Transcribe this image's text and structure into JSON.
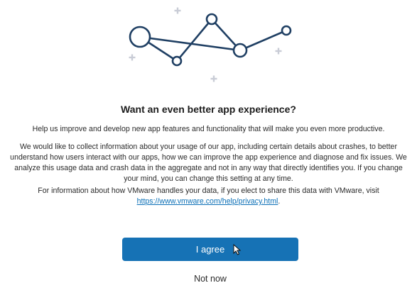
{
  "dialog": {
    "title": "Want an even better app experience?",
    "intro": "Help us improve and develop new app features and functionality that will make you even more productive.",
    "details": "We would like to collect information about your usage of our app, including certain details about crashes, to better understand how users interact with our apps, how we can improve the app experience and diagnose and fix issues. We analyze this usage data and crash data in the aggregate and not in any way that directly identifies you. If you change your mind, you can change this setting at any time.",
    "privacy_text": "For information about how VMware handles your data, if you elect to share this data with VMware, visit ",
    "privacy_link": "https://www.vmware.com/help/privacy.html",
    "privacy_suffix": "."
  },
  "actions": {
    "agree_label": "I agree",
    "not_now_label": "Not now"
  },
  "colors": {
    "primary": "#1672b5",
    "network": "#1f3f63",
    "sparkle": "#c9ccd6",
    "link": "#0a6fb6"
  },
  "icons": [
    "network-illustration",
    "sparkle-icon",
    "mouse-pointer-icon"
  ]
}
